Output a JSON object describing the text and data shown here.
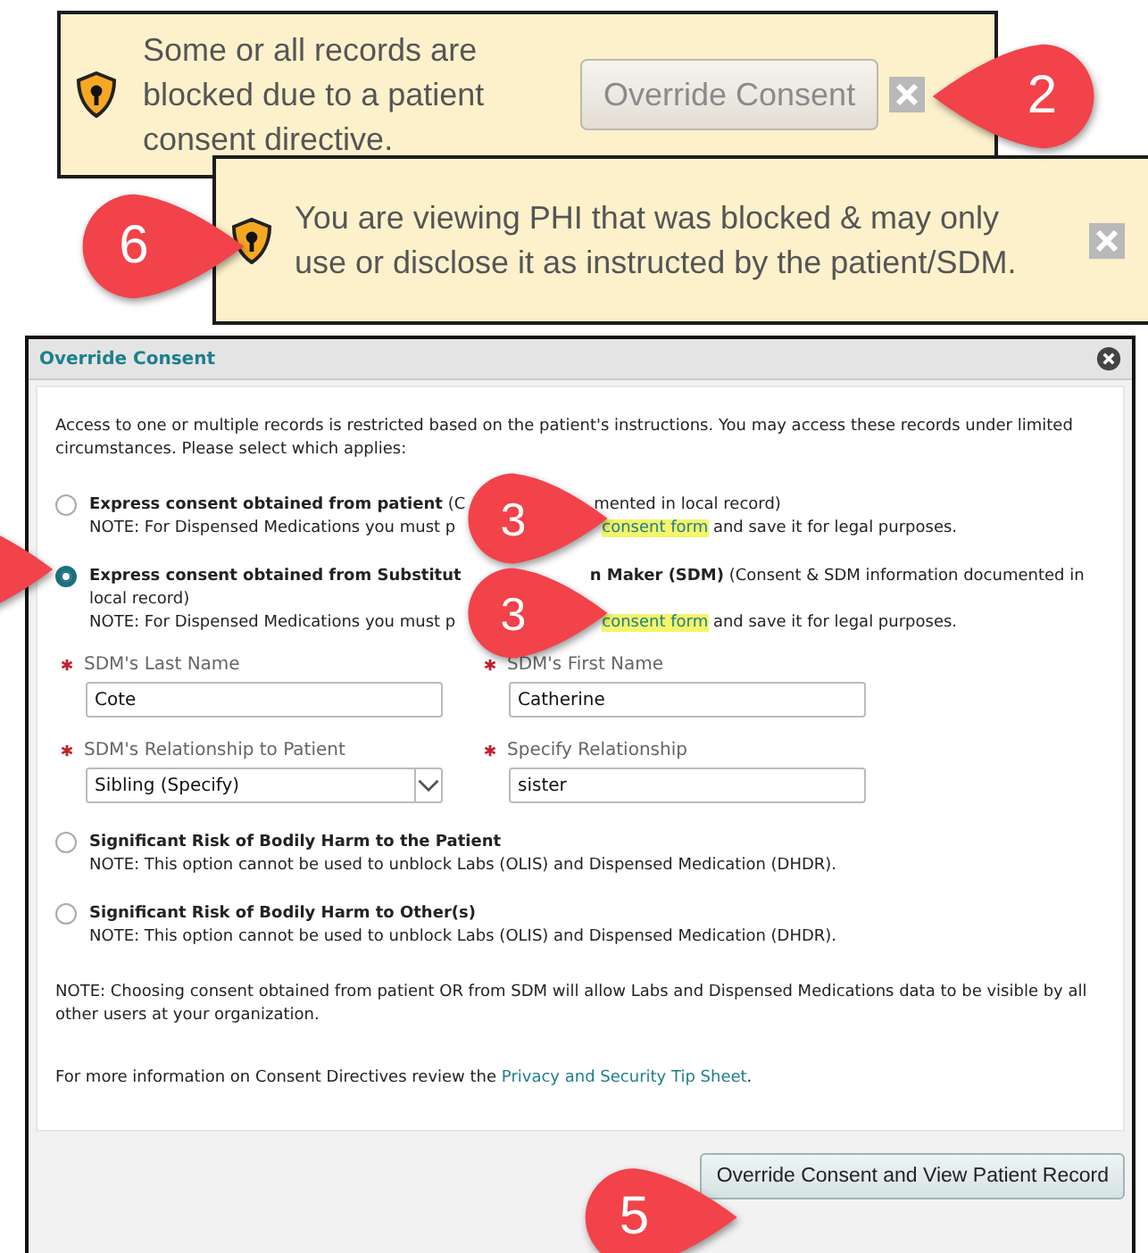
{
  "banners": [
    {
      "text": "Some or all records are blocked due to a patient consent directive.",
      "button": "Override Consent",
      "button_disabled": true
    },
    {
      "text": "You are viewing PHI that was blocked & may only use or disclose it as instructed by the patient/SDM."
    }
  ],
  "callouts": [
    {
      "label": "2",
      "kind": "left"
    },
    {
      "label": "6",
      "kind": "right"
    },
    {
      "kind": "right"
    },
    {
      "label": "5",
      "kind": "right"
    }
  ],
  "dialog": {
    "title": "Override Consent",
    "intro": "Access to one or multiple records is restricted based on the patient's instructions. You may access these records under limited circumstances. Please select which applies:",
    "options": [
      {
        "selected": false,
        "lines": [
          [
            {
              "kind": "bold",
              "text": "Express consent obtained from patient"
            },
            {
              "kind": "plain",
              "text": " (C"
            },
            {
              "kind": "covered"
            },
            {
              "kind": "plain",
              "text": "mented in local record)"
            }
          ],
          [
            {
              "kind": "plain",
              "text": "NOTE: For Dispensed Medications you must p"
            },
            {
              "kind": "callout",
              "label": "3"
            },
            {
              "kind": "link",
              "text": "consent form"
            },
            {
              "kind": "plain",
              "text": " and save it for legal purposes."
            }
          ]
        ]
      },
      {
        "selected": true,
        "lines": [
          [
            {
              "kind": "bold",
              "text": "Express consent obtained from Substitut"
            },
            {
              "kind": "covered"
            },
            {
              "kind": "bold",
              "text": "n Maker (SDM)"
            },
            {
              "kind": "plain",
              "text": " (Consent & SDM information documented in"
            }
          ],
          [
            {
              "kind": "plain",
              "text": "local record)"
            }
          ],
          [
            {
              "kind": "plain",
              "text": "NOTE: For Dispensed Medications you must p"
            },
            {
              "kind": "callout",
              "label": "3"
            },
            {
              "kind": "link",
              "text": "consent form"
            },
            {
              "kind": "plain",
              "text": " and save it for legal purposes."
            }
          ]
        ],
        "fields": [
          {
            "label": "SDM's Last Name",
            "required": true,
            "kind": "text",
            "value": "Cote"
          },
          {
            "label": "SDM's First Name",
            "required": true,
            "kind": "text",
            "value": "Catherine"
          },
          {
            "label": "SDM's Relationship to Patient",
            "required": true,
            "kind": "select",
            "value": "Sibling (Specify)"
          },
          {
            "label": "Specify Relationship",
            "required": true,
            "kind": "text",
            "value": "sister"
          }
        ]
      },
      {
        "selected": false,
        "lines": [
          [
            {
              "kind": "bold",
              "text": "Significant Risk of Bodily Harm to the Patient"
            }
          ],
          [
            {
              "kind": "plain",
              "text": "NOTE: This option cannot be used to unblock Labs (OLIS) and Dispensed Medication (DHDR)."
            }
          ]
        ]
      },
      {
        "selected": false,
        "lines": [
          [
            {
              "kind": "bold",
              "text": "Significant Risk of Bodily Harm to Other(s)"
            }
          ],
          [
            {
              "kind": "plain",
              "text": "NOTE: This option cannot be used to unblock Labs (OLIS) and Dispensed Medication (DHDR)."
            }
          ]
        ]
      }
    ],
    "note": "NOTE: Choosing consent obtained from patient OR from SDM will allow Labs and Dispensed Medications data to be visible by all other users at your organization.",
    "info_text": "For more information on Consent Directives review the",
    "info_link": "Privacy and Security Tip Sheet",
    "info_end": ".",
    "submit": "Override Consent and View Patient Record"
  }
}
